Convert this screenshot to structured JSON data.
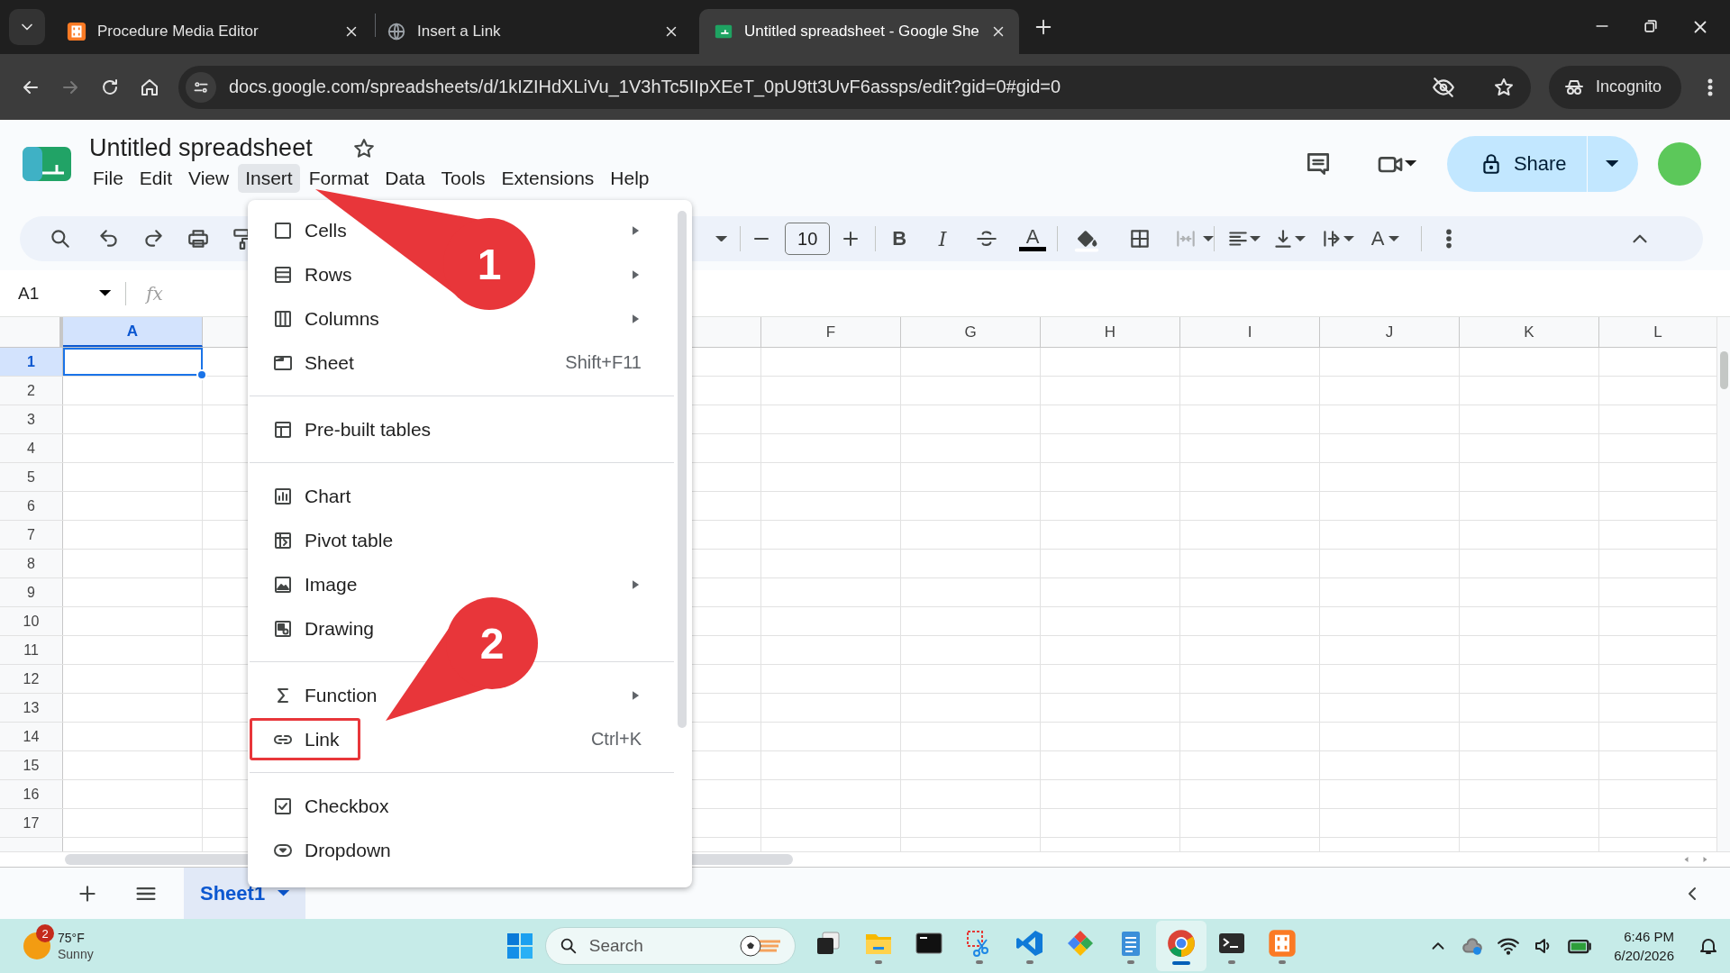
{
  "browser": {
    "tabs": [
      {
        "kind": "xampp",
        "title": "Procedure Media Editor",
        "selected": false
      },
      {
        "kind": "globe",
        "title": "Insert a Link",
        "selected": false
      },
      {
        "kind": "sheets",
        "title": "Untitled spreadsheet - Google She",
        "selected": true
      }
    ],
    "address": "docs.google.com/spreadsheets/d/1kIZIHdXLiVu_1V3hTc5IIpXEeT_0pU9tt3UvF6assps/edit?gid=0#gid=0",
    "profile": "Incognito"
  },
  "document": {
    "title": "Untitled spreadsheet",
    "share_label": "Share",
    "menus": [
      {
        "label": "File",
        "selected": false
      },
      {
        "label": "Edit",
        "selected": false
      },
      {
        "label": "View",
        "selected": false
      },
      {
        "label": "Insert",
        "selected": true
      },
      {
        "label": "Format",
        "selected": false
      },
      {
        "label": "Data",
        "selected": false
      },
      {
        "label": "Tools",
        "selected": false
      },
      {
        "label": "Extensions",
        "selected": false
      },
      {
        "label": "Help",
        "selected": false
      }
    ]
  },
  "toolbar": {
    "font_size": "10",
    "bold_glyph": "B",
    "italic_glyph": "I",
    "text_color_glyph": "A",
    "rotate_glyph": "A"
  },
  "formula_bar": {
    "cell_ref": "A1",
    "fx_label": "fx"
  },
  "grid": {
    "columns": [
      {
        "label": "A",
        "selected": true
      },
      {
        "label": "F",
        "selected": false
      },
      {
        "label": "G",
        "selected": false
      },
      {
        "label": "H",
        "selected": false
      },
      {
        "label": "I",
        "selected": false
      },
      {
        "label": "J",
        "selected": false
      },
      {
        "label": "K",
        "selected": false
      },
      {
        "label": "L",
        "selected": false
      }
    ],
    "rows": [
      {
        "label": "1",
        "selected": true
      },
      {
        "label": "2",
        "selected": false
      },
      {
        "label": "3",
        "selected": false
      },
      {
        "label": "4",
        "selected": false
      },
      {
        "label": "5",
        "selected": false
      },
      {
        "label": "6",
        "selected": false
      },
      {
        "label": "7",
        "selected": false
      },
      {
        "label": "8",
        "selected": false
      },
      {
        "label": "9",
        "selected": false
      },
      {
        "label": "10",
        "selected": false
      },
      {
        "label": "11",
        "selected": false
      },
      {
        "label": "12",
        "selected": false
      },
      {
        "label": "13",
        "selected": false
      },
      {
        "label": "14",
        "selected": false
      },
      {
        "label": "15",
        "selected": false
      },
      {
        "label": "16",
        "selected": false
      },
      {
        "label": "17",
        "selected": false
      }
    ]
  },
  "insert_menu": {
    "items": [
      {
        "kind": "item",
        "label": "Cells",
        "submenu": true,
        "outlined": false
      },
      {
        "kind": "item",
        "label": "Rows",
        "submenu": true,
        "outlined": false
      },
      {
        "kind": "item",
        "label": "Columns",
        "submenu": true,
        "outlined": false
      },
      {
        "kind": "item",
        "label": "Sheet",
        "shortcut": "Shift+F11",
        "submenu": false,
        "outlined": false
      },
      {
        "kind": "separator"
      },
      {
        "kind": "item",
        "label": "Pre-built tables",
        "submenu": false,
        "outlined": false
      },
      {
        "kind": "separator"
      },
      {
        "kind": "item",
        "label": "Chart",
        "submenu": false,
        "outlined": false
      },
      {
        "kind": "item",
        "label": "Pivot table",
        "submenu": false,
        "outlined": false
      },
      {
        "kind": "item",
        "label": "Image",
        "submenu": true,
        "outlined": false
      },
      {
        "kind": "item",
        "label": "Drawing",
        "submenu": false,
        "outlined": false
      },
      {
        "kind": "separator"
      },
      {
        "kind": "item",
        "label": "Function",
        "submenu": true,
        "outlined": false
      },
      {
        "kind": "item",
        "label": "Link",
        "shortcut": "Ctrl+K",
        "submenu": false,
        "outlined": true
      },
      {
        "kind": "separator"
      },
      {
        "kind": "item",
        "label": "Checkbox",
        "submenu": false,
        "outlined": false
      },
      {
        "kind": "item",
        "label": "Dropdown",
        "submenu": false,
        "outlined": false
      }
    ]
  },
  "annotations": [
    {
      "label": "1"
    },
    {
      "label": "2"
    }
  ],
  "sheet_tabs": [
    {
      "label": "Sheet1",
      "selected": true
    }
  ],
  "taskbar": {
    "weather": {
      "badge": "2",
      "temperature": "75°F",
      "condition": "Sunny"
    },
    "search_placeholder": "Search",
    "apps": [
      {
        "kind": "task-view",
        "running": false,
        "selected": false
      },
      {
        "kind": "folder",
        "running": true,
        "selected": false
      },
      {
        "kind": "console",
        "running": false,
        "selected": false
      },
      {
        "kind": "snip",
        "running": true,
        "selected": false
      },
      {
        "kind": "code",
        "running": true,
        "selected": false
      },
      {
        "kind": "diamonds",
        "running": false,
        "selected": false
      },
      {
        "kind": "notepad",
        "running": true,
        "selected": false
      },
      {
        "kind": "chrome",
        "running": true,
        "selected": true
      },
      {
        "kind": "terminal",
        "running": true,
        "selected": false
      },
      {
        "kind": "xampp",
        "running": true,
        "selected": false
      }
    ],
    "time": "6:46 PM",
    "date": "6/20/2026"
  }
}
